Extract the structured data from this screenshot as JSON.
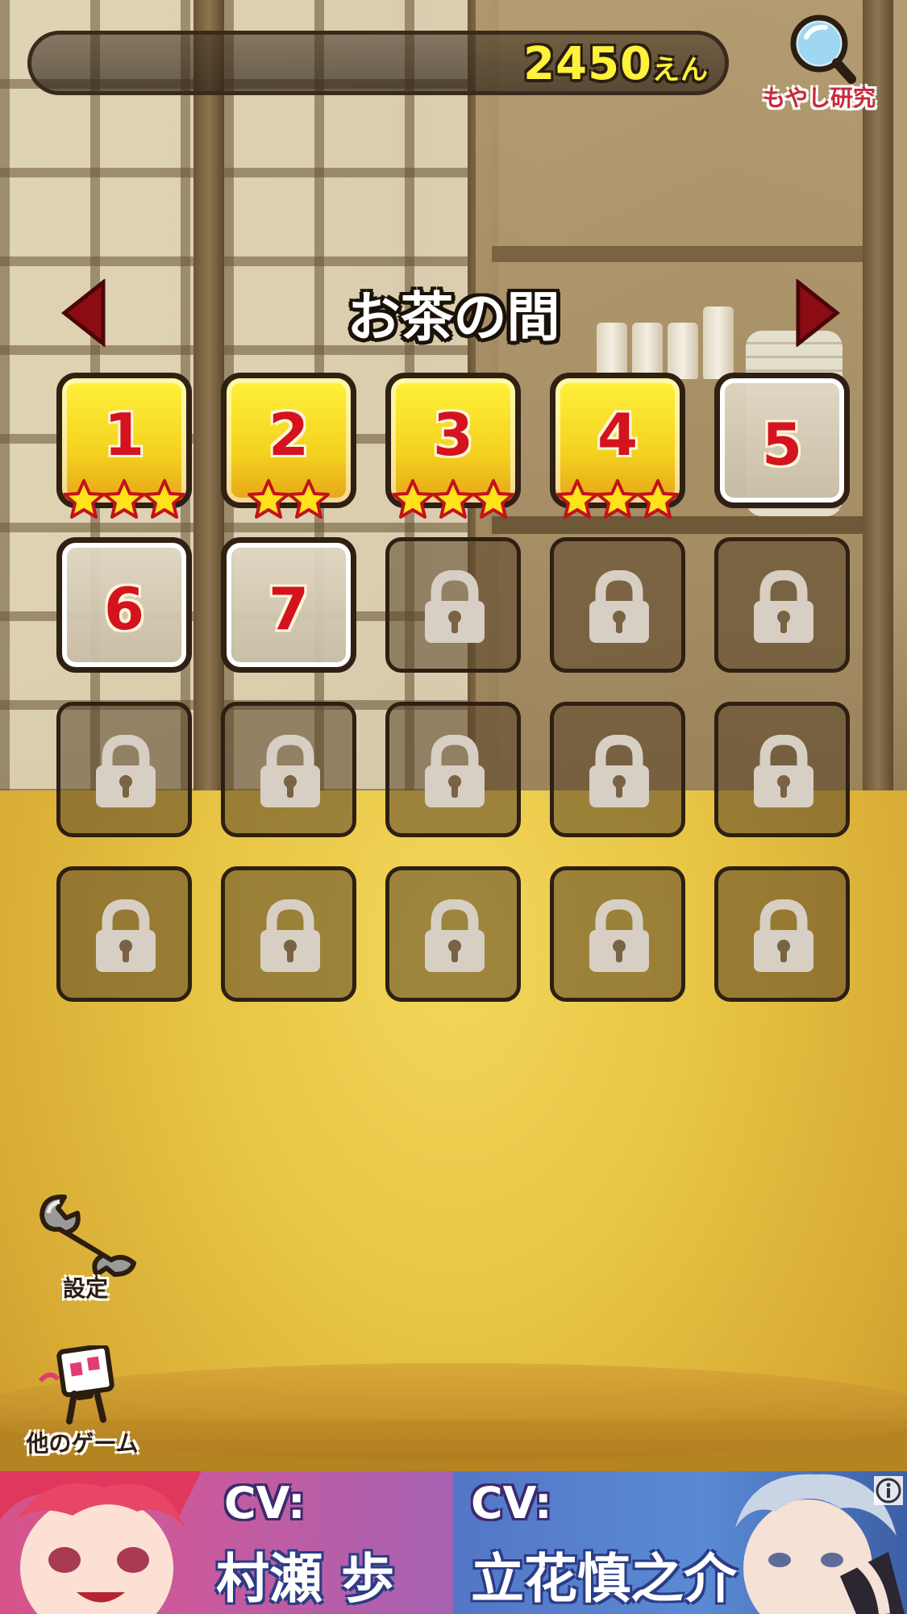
{
  "header": {
    "coins": "2450",
    "coin_unit": "えん",
    "research_label": "もやし研究"
  },
  "room": {
    "title": "お茶の間"
  },
  "levels": [
    {
      "number": "1",
      "state": "cleared",
      "stars": 3
    },
    {
      "number": "2",
      "state": "cleared",
      "stars": 2
    },
    {
      "number": "3",
      "state": "cleared",
      "stars": 3
    },
    {
      "number": "4",
      "state": "cleared",
      "stars": 3
    },
    {
      "number": "5",
      "state": "open",
      "stars": 0
    },
    {
      "number": "6",
      "state": "open",
      "stars": 0
    },
    {
      "number": "7",
      "state": "open",
      "stars": 0
    },
    {
      "number": "",
      "state": "locked"
    },
    {
      "number": "",
      "state": "locked"
    },
    {
      "number": "",
      "state": "locked"
    },
    {
      "number": "",
      "state": "locked"
    },
    {
      "number": "",
      "state": "locked"
    },
    {
      "number": "",
      "state": "locked"
    },
    {
      "number": "",
      "state": "locked"
    },
    {
      "number": "",
      "state": "locked"
    },
    {
      "number": "",
      "state": "locked"
    },
    {
      "number": "",
      "state": "locked"
    },
    {
      "number": "",
      "state": "locked"
    },
    {
      "number": "",
      "state": "locked"
    },
    {
      "number": "",
      "state": "locked"
    }
  ],
  "side_buttons": {
    "settings_label": "設定",
    "other_games_label": "他のゲーム"
  },
  "ad": {
    "left_cv": "CV:",
    "left_name": "村瀬 歩",
    "right_cv": "CV:",
    "right_name": "立花慎之介",
    "info_icon": "info-icon"
  },
  "colors": {
    "coin_text": "#fff23a",
    "level_number": "#d4131f",
    "star": "#ffe21a",
    "arrow": "#8b0c12"
  }
}
